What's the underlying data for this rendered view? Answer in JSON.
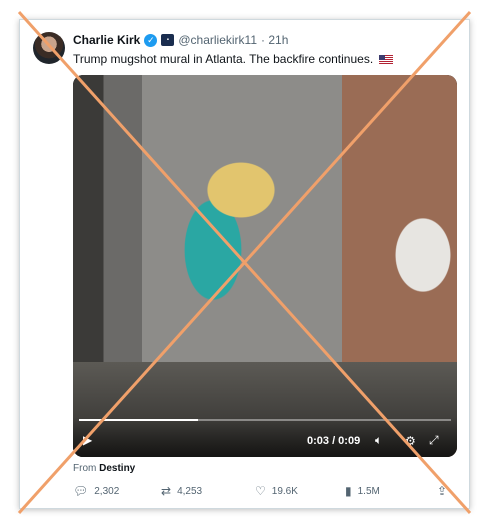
{
  "tweet": {
    "author_name": "Charlie Kirk",
    "handle": "@charliekirk11",
    "time": "· 21h",
    "text": "Trump mugshot mural in Atlanta. The backfire continues."
  },
  "video": {
    "current_time": "0:03 / 0:09",
    "progress": 0.32
  },
  "attribution": {
    "prefix": "From",
    "source": "Destiny"
  },
  "metrics": {
    "replies": "2,302",
    "reposts": "4,253",
    "likes": "19.6K",
    "views": "1.5M"
  },
  "colors": {
    "overlay_x": "#f0a06a",
    "verified": "#1d9bf0"
  }
}
